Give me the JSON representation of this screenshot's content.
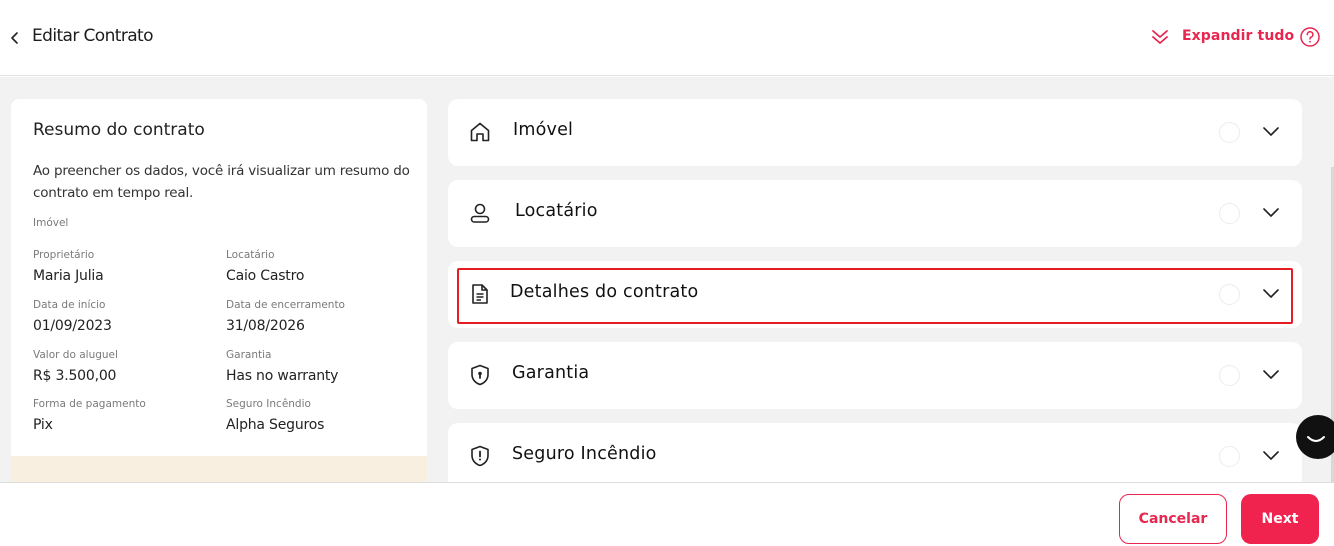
{
  "header": {
    "title": "Editar Contrato",
    "expand_all": "Expandir tudo",
    "back_icon": "chevron-left-icon",
    "expand_icon": "double-chevron-down-icon",
    "help_icon": "question-circle-icon",
    "accent_color": "#e8264f"
  },
  "summary": {
    "title": "Resumo do contrato",
    "description": "Ao preencher os dados, você irá visualizar um resumo do contrato em tempo real.",
    "property_label": "Imóvel",
    "fields": [
      {
        "label": "Proprietário",
        "value": "Maria Julia"
      },
      {
        "label": "Locatário",
        "value": "Caio Castro"
      },
      {
        "label": "Data de início",
        "value": "01/09/2023"
      },
      {
        "label": "Data de encerramento",
        "value": "31/08/2026"
      },
      {
        "label": "Valor do aluguel",
        "value": "R$ 3.500,00"
      },
      {
        "label": "Garantia",
        "value": "Has no warranty"
      },
      {
        "label": "Forma de pagamento",
        "value": "Pix"
      },
      {
        "label": "Seguro Incêndio",
        "value": "Alpha Seguros"
      }
    ]
  },
  "sections": [
    {
      "title": "Imóvel",
      "icon": "home-icon"
    },
    {
      "title": "Locatário",
      "icon": "user-icon"
    },
    {
      "title": "Detalhes do contrato",
      "icon": "document-icon",
      "highlighted": true
    },
    {
      "title": "Garantia",
      "icon": "shield-lock-icon"
    },
    {
      "title": "Seguro Incêndio",
      "icon": "shield-alert-icon"
    }
  ],
  "footer": {
    "cancel": "Cancelar",
    "next": "Next"
  }
}
